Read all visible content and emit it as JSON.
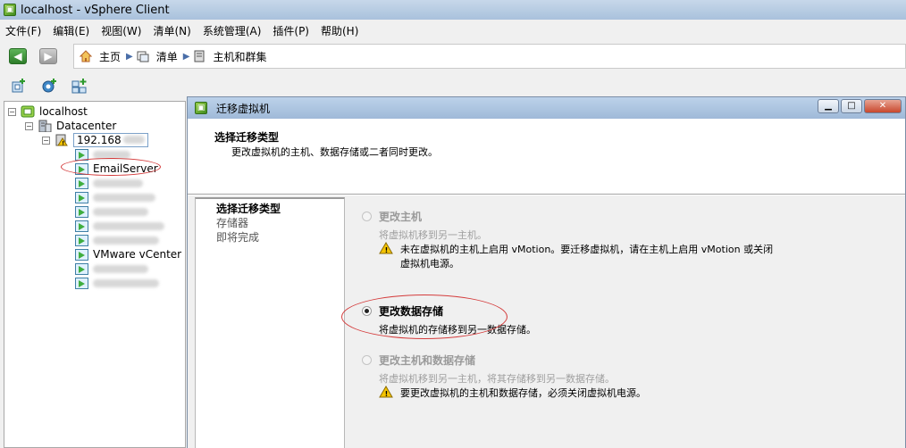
{
  "window": {
    "title": "localhost - vSphere Client"
  },
  "menu": [
    "文件(F)",
    "编辑(E)",
    "视图(W)",
    "清单(N)",
    "系统管理(A)",
    "插件(P)",
    "帮助(H)"
  ],
  "breadcrumb": {
    "home": "主页",
    "inventory": "清单",
    "hosts_clusters": "主机和群集"
  },
  "tree": {
    "root": "localhost",
    "datacenter": "Datacenter",
    "host": "192.168",
    "vm_email": "EmailServer",
    "vm_vcenter": "VMware vCenter Se"
  },
  "dialog": {
    "title": "迁移虚拟机",
    "header_title": "选择迁移类型",
    "header_desc": "更改虚拟机的主机、数据存储或二者同时更改。",
    "steps": [
      "选择迁移类型",
      "存储器",
      "即将完成"
    ],
    "options": {
      "change_host": {
        "label": "更改主机",
        "desc": "将虚拟机移到另一主机。",
        "warning_line1": "未在虚拟机的主机上启用 vMotion。要迁移虚拟机，请在主机上启用 vMotion 或关闭",
        "warning_line2": "虚拟机电源。"
      },
      "change_datastore": {
        "label": "更改数据存储",
        "desc": "将虚拟机的存储移到另一数据存储。"
      },
      "change_both": {
        "label": "更改主机和数据存储",
        "desc": "将虚拟机移到另一主机，将其存储移到另一数据存储。",
        "warning": "要更改虚拟机的主机和数据存储，必须关闭虚拟机电源。"
      }
    }
  },
  "colors": {
    "annotation": "#d43b3b",
    "titlebar": "#a9c1dc"
  }
}
